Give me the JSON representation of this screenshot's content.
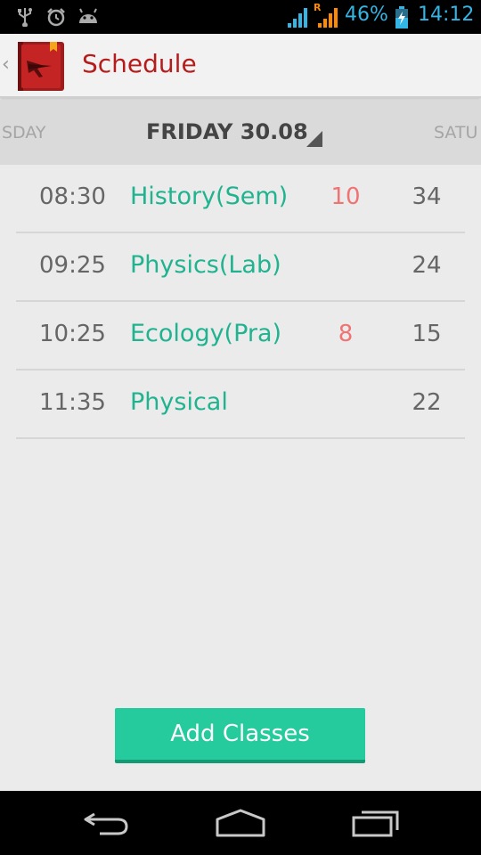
{
  "status_bar": {
    "battery_percent": "46%",
    "time": "14:12",
    "roaming_indicator": "R",
    "icons": [
      "usb-icon",
      "alarm-icon",
      "android-icon",
      "signal-icon",
      "signal-roaming-icon",
      "battery-charging-icon"
    ]
  },
  "action_bar": {
    "title": "Schedule",
    "up_caret": "‹"
  },
  "day_strip": {
    "prev_day": "SDAY",
    "current_day": "FRIDAY 30.08",
    "next_day": "SATU"
  },
  "classes": [
    {
      "time": "08:30",
      "name": "History(Sem)",
      "count": "10",
      "room": "34"
    },
    {
      "time": "09:25",
      "name": "Physics(Lab)",
      "count": "",
      "room": "24"
    },
    {
      "time": "10:25",
      "name": "Ecology(Pra)",
      "count": "8",
      "room": "15"
    },
    {
      "time": "11:35",
      "name": "Physical",
      "count": "",
      "room": "22"
    }
  ],
  "add_button_label": "Add Classes",
  "nav_bar": {
    "icons": [
      "back-icon",
      "home-icon",
      "recents-icon"
    ]
  },
  "colors": {
    "accent_green": "#25cb9d",
    "class_name": "#1fb38f",
    "count_red": "#ef7373",
    "title_red": "#b51c1c",
    "status_blue": "#33b5e5"
  }
}
